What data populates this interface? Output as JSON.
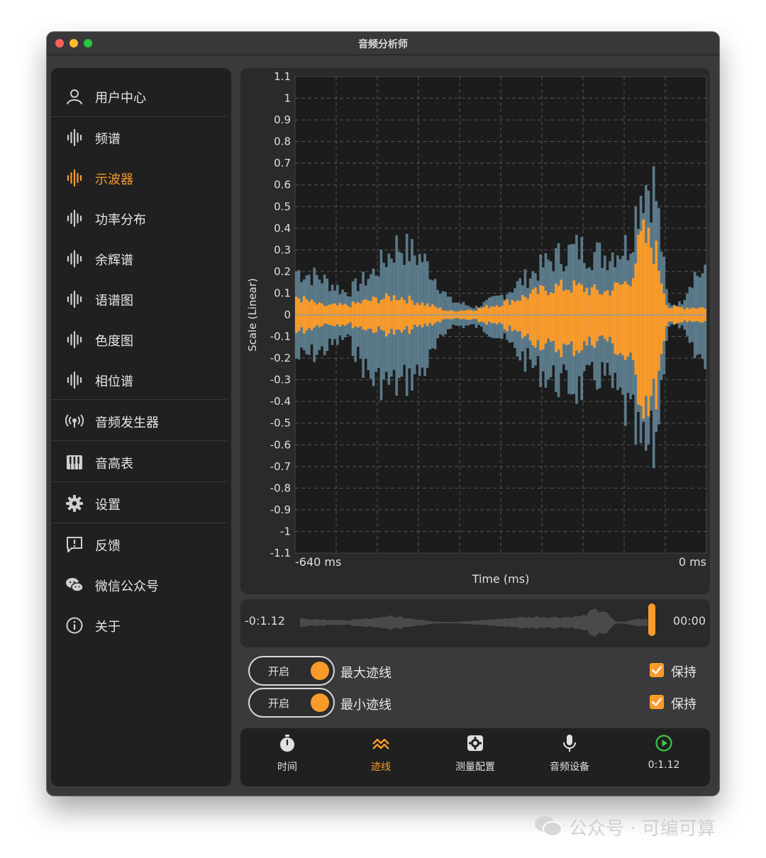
{
  "window": {
    "title": "音频分析师"
  },
  "sidebar": {
    "items": [
      {
        "label": "用户中心",
        "icon": "user-icon"
      },
      {
        "label": "频谱",
        "icon": "waveform-icon"
      },
      {
        "label": "示波器",
        "icon": "waveform-icon",
        "active": true
      },
      {
        "label": "功率分布",
        "icon": "waveform-icon"
      },
      {
        "label": "余辉谱",
        "icon": "waveform-icon"
      },
      {
        "label": "语谱图",
        "icon": "waveform-icon"
      },
      {
        "label": "色度图",
        "icon": "waveform-icon"
      },
      {
        "label": "相位谱",
        "icon": "waveform-icon"
      },
      {
        "label": "音频发生器",
        "icon": "broadcast-icon"
      },
      {
        "label": "音高表",
        "icon": "piano-icon"
      },
      {
        "label": "设置",
        "icon": "gear-icon"
      },
      {
        "label": "反馈",
        "icon": "feedback-icon"
      },
      {
        "label": "微信公众号",
        "icon": "wechat-icon"
      },
      {
        "label": "关于",
        "icon": "info-icon"
      }
    ]
  },
  "chart_data": {
    "type": "area",
    "title": "",
    "xlabel": "Time (ms)",
    "ylabel": "Scale (Linear)",
    "xlim": [
      -640,
      0
    ],
    "ylim": [
      -1.1,
      1.1
    ],
    "x_tick_labels": [
      "-640 ms",
      "0 ms"
    ],
    "y_ticks": [
      1.1,
      1,
      0.9,
      0.8,
      0.7,
      0.6,
      0.5,
      0.4,
      0.3,
      0.2,
      0.1,
      0,
      -0.1,
      -0.2,
      -0.3,
      -0.4,
      -0.5,
      -0.6,
      -0.7,
      -0.8,
      -0.9,
      -1,
      -1.1
    ],
    "grid": true,
    "series": [
      {
        "name": "",
        "color": "#5b7a8a",
        "x": [
          -640,
          -600,
          -560,
          -520,
          -480,
          -440,
          -400,
          -360,
          -320,
          -280,
          -240,
          -200,
          -160,
          -120,
          -100,
          -80,
          -60,
          -40,
          -20,
          0
        ],
        "max": [
          0.24,
          0.2,
          0.12,
          0.22,
          0.38,
          0.3,
          0.08,
          0.04,
          0.1,
          0.2,
          0.3,
          0.36,
          0.32,
          0.38,
          0.72,
          0.7,
          0.06,
          0.06,
          0.22,
          0.22
        ],
        "min": [
          -0.24,
          -0.2,
          -0.12,
          -0.35,
          -0.38,
          -0.3,
          -0.06,
          -0.06,
          -0.12,
          -0.25,
          -0.35,
          -0.4,
          -0.32,
          -0.55,
          -0.76,
          -0.72,
          -0.06,
          -0.06,
          -0.22,
          -0.24
        ]
      },
      {
        "name": "",
        "color": "#f99b2b",
        "x": [
          -640,
          -600,
          -560,
          -520,
          -480,
          -440,
          -400,
          -360,
          -320,
          -280,
          -240,
          -200,
          -160,
          -120,
          -100,
          -80,
          -60,
          -40,
          -20,
          0
        ],
        "max": [
          0.1,
          0.05,
          0.05,
          0.08,
          0.1,
          0.06,
          0.02,
          0.03,
          0.06,
          0.1,
          0.15,
          0.15,
          0.12,
          0.18,
          0.42,
          0.36,
          0.04,
          0.04,
          0.04,
          0.04
        ],
        "min": [
          -0.1,
          -0.05,
          -0.05,
          -0.08,
          -0.1,
          -0.06,
          -0.02,
          -0.03,
          -0.06,
          -0.12,
          -0.18,
          -0.18,
          -0.12,
          -0.25,
          -0.45,
          -0.46,
          -0.04,
          -0.04,
          -0.04,
          -0.04
        ]
      }
    ]
  },
  "scrubber": {
    "left_time": "-0:1.12",
    "right_time": "00:00"
  },
  "traces": [
    {
      "toggle_label": "开启",
      "label": "最大迹线",
      "check_label": "保持"
    },
    {
      "toggle_label": "开启",
      "label": "最小迹线",
      "check_label": "保持"
    }
  ],
  "tabs": [
    {
      "label": "时间",
      "icon": "stopwatch-icon"
    },
    {
      "label": "迹线",
      "icon": "trace-icon",
      "active": true
    },
    {
      "label": "测量配置",
      "icon": "settings-box-icon"
    },
    {
      "label": "音频设备",
      "icon": "microphone-icon"
    },
    {
      "label": "0:1.12",
      "icon": "play-circle-icon"
    }
  ],
  "colors": {
    "accent": "#f99b2b",
    "wave": "#5b7a8a",
    "play": "#3ec64a"
  },
  "watermark": "公众号 · 可编可算"
}
